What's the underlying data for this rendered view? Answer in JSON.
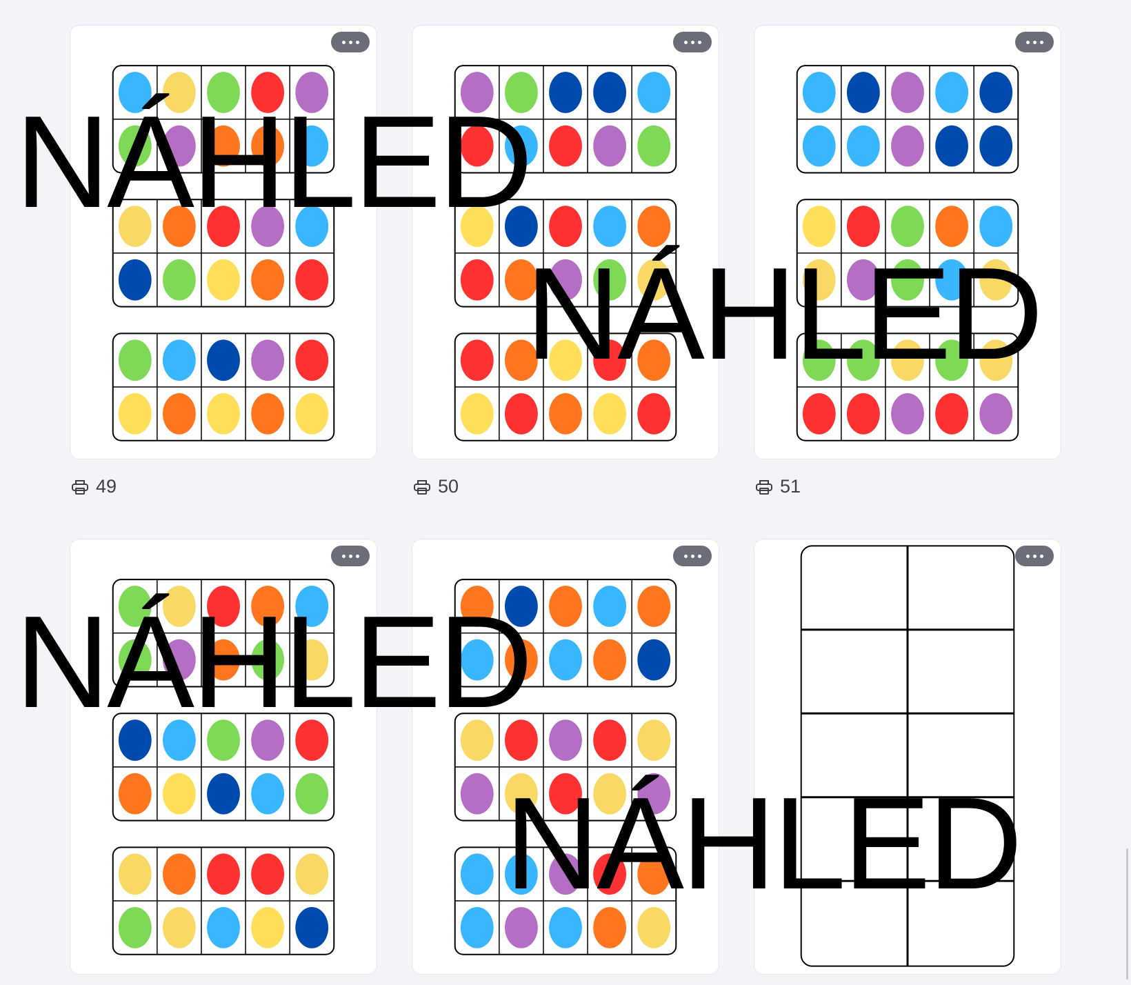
{
  "watermark": {
    "text": "NÁHLED"
  },
  "palette": {
    "R": "#ff3131",
    "O": "#ff761f",
    "Y": "#ffde59",
    "y": "#f9d966",
    "G": "#7ed957",
    "L": "#38b6ff",
    "B": "#004aad",
    "P": "#b46fc5"
  },
  "cards": [
    {
      "id": "49",
      "print_count": "49",
      "kind": "tens",
      "frames": [
        [
          "LyGRP",
          "GPOOL"
        ],
        [
          "yORPL",
          "BGYOR"
        ],
        [
          "GLBPR",
          "YOYOY"
        ]
      ]
    },
    {
      "id": "50",
      "print_count": "50",
      "kind": "tens",
      "frames": [
        [
          "PGBBL",
          "RLRPG"
        ],
        [
          "YBRLO",
          "ROPGy"
        ],
        [
          "ROYRO",
          "YROYR"
        ]
      ]
    },
    {
      "id": "51",
      "print_count": "51",
      "kind": "tens",
      "frames": [
        [
          "LBPLB",
          "LLPBB"
        ],
        [
          "YRGOL",
          "yPGLy"
        ],
        [
          "GGyGy",
          "RRPRP"
        ]
      ]
    },
    {
      "id": "52",
      "print_count": "",
      "kind": "tens",
      "frames": [
        [
          "GyROL",
          "GPOGy"
        ],
        [
          "BLGPR",
          "OYBLG"
        ],
        [
          "yORRy",
          "GyLYB"
        ]
      ]
    },
    {
      "id": "53",
      "print_count": "",
      "kind": "tens",
      "frames": [
        [
          "OBOLO",
          "LOLOB"
        ],
        [
          "yRPRy",
          "PyRyP"
        ],
        [
          "LLPRO",
          "LPLOy"
        ]
      ]
    },
    {
      "id": "54",
      "print_count": "",
      "kind": "blank"
    }
  ],
  "print_icon": "printer-icon",
  "more_icon": "more-horizontal-icon"
}
